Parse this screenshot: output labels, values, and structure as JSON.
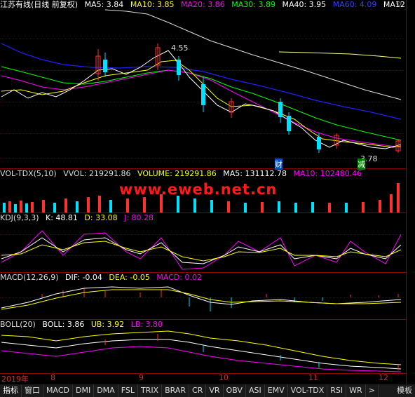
{
  "main": {
    "title": "江苏有线(日线 前复权)",
    "ma5": "MA5: 3.84",
    "ma10": "MA10: 3.85",
    "ma20": "MA20: 3.86",
    "ma30": "MA30: 3.89",
    "ma40": "MA40: 3.95",
    "ma60": "MA60: 4.09",
    "ma120": "MA12",
    "high_label": "4.55",
    "low_label": "3.78",
    "event_cai": "财",
    "event_jian": "减",
    "colors": {
      "ma5": "#ffffff",
      "ma10": "#ffff00",
      "ma20": "#ff00ff",
      "ma30": "#00ff00",
      "ma40": "#ffffff",
      "ma60": "#0000ff",
      "up": "#ff3030",
      "down": "#00e0ff"
    }
  },
  "volume": {
    "title": "VOL-TDX(5,10)",
    "vvol": "VVOL: 219291.86",
    "volume": "VOLUME: 219291.86",
    "ma5": "MA5: 131112.78",
    "ma10": "MA10: 102480.46"
  },
  "watermark": "www.eweb.net.cn",
  "kdj": {
    "title": "KDJ(9,3,3)",
    "k": "K: 48.81",
    "d": "D: 33.08",
    "j": "J: 80.28"
  },
  "macd": {
    "title": "MACD(12,26,9)",
    "dif": "DIF: -0.04",
    "dea": "DEA: -0.05",
    "macd": "MACD: 0.02"
  },
  "boll": {
    "title": "BOLL(20)",
    "boll": "BOLL: 3.86",
    "ub": "UB: 3.92",
    "lb": "LB: 3.80"
  },
  "xaxis": {
    "year": "2019年",
    "m8": "8",
    "m9": "9",
    "m10": "10",
    "m11": "11",
    "m12": "12"
  },
  "toolbar": {
    "items": [
      "指标",
      "窗口",
      "MACD",
      "DMI",
      "DMA",
      "FSL",
      "TRIX",
      "BRAR",
      "CR",
      "VR",
      "OBV",
      "ASI",
      "EMV",
      "VOL-TDX",
      "RSI",
      "WR",
      ">",
      "模板"
    ]
  }
}
